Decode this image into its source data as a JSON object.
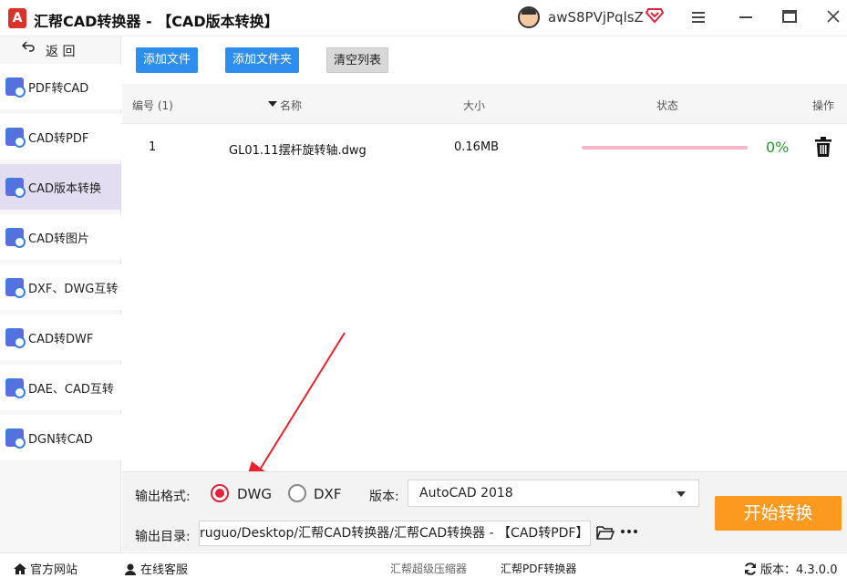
{
  "window": {
    "title": "汇帮CAD转换器 - 【CAD版本转换】",
    "logo_letter": "A",
    "username": "awS8PVjPqlsZ"
  },
  "sidebar": {
    "back_label": "返 回",
    "items": [
      {
        "label": "PDF转CAD",
        "active": false
      },
      {
        "label": "CAD转PDF",
        "active": false
      },
      {
        "label": "CAD版本转换",
        "active": true
      },
      {
        "label": "CAD转图片",
        "active": false
      },
      {
        "label": "DXF、DWG互转",
        "active": false
      },
      {
        "label": "CAD转DWF",
        "active": false
      },
      {
        "label": "DAE、CAD互转",
        "active": false
      },
      {
        "label": "DGN转CAD",
        "active": false
      }
    ]
  },
  "toolbar": {
    "add_file": "添加文件",
    "add_folder": "添加文件夹",
    "clear_list": "清空列表"
  },
  "table": {
    "columns": {
      "index": "编号 (1)",
      "name": "名称",
      "size": "大小",
      "status": "状态",
      "action": "操作"
    },
    "rows": [
      {
        "index": "1",
        "name": "GL01.11摆杆旋转轴.dwg",
        "size": "0.16MB",
        "progress_percent": 0,
        "progress_text": "0%"
      }
    ]
  },
  "settings": {
    "format_label": "输出格式:",
    "format_options": [
      {
        "label": "DWG",
        "selected": true
      },
      {
        "label": "DXF",
        "selected": false
      }
    ],
    "version_label": "版本:",
    "version_value": "AutoCAD 2018",
    "output_label": "输出目录:",
    "output_path": "ruguo/Desktop/汇帮CAD转换器/汇帮CAD转换器 - 【CAD转PDF】",
    "start_button": "开始转换"
  },
  "statusbar": {
    "website": "官方网站",
    "support": "在线客服",
    "link1": "汇帮超级压缩器",
    "link2": "汇帮PDF转换器",
    "version": "版本：4.3.0.0"
  },
  "colors": {
    "accent_blue": "#2e8ef0",
    "start_orange": "#fb9a1e",
    "radio_red": "#e0243b",
    "progress_green": "#2a9a2a",
    "active_nav": "#e3ddf2"
  }
}
